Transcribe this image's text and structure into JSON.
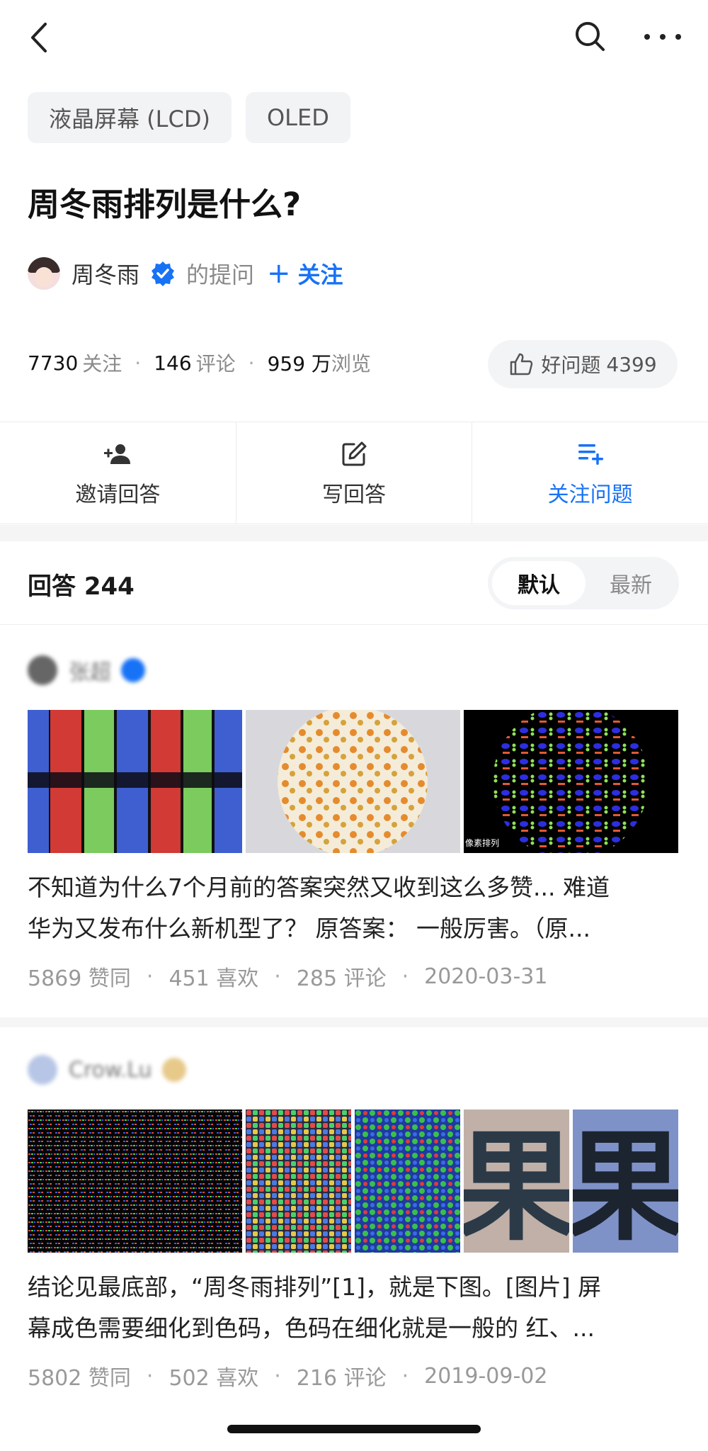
{
  "topbar": {
    "back_icon": "chevron-left-icon",
    "search_icon": "search-icon",
    "more_icon": "more-horizontal-icon"
  },
  "tags": [
    "液晶屏幕 (LCD)",
    "OLED"
  ],
  "question": {
    "title": "周冬雨排列是什么?",
    "asker_name": "周冬雨",
    "asked_label": "的提问",
    "follow_label": "关注"
  },
  "stats": {
    "followers": "7730",
    "followers_label": "关注",
    "comments": "146",
    "comments_label": "评论",
    "views": "959 万",
    "views_label": "浏览",
    "good_question_label": "好问题",
    "good_question_count": "4399"
  },
  "actions": {
    "invite": "邀请回答",
    "write": "写回答",
    "follow_question": "关注问题"
  },
  "answers": {
    "title": "回答 244",
    "sort_default": "默认",
    "sort_latest": "最新",
    "items": [
      {
        "author": "张超",
        "excerpt_line1": "不知道为什么7个月前的答案突然又收到这么多赞... 难道",
        "excerpt_line2": "华为又发布什么新机型了？ 原答案： 一般厉害。（原...",
        "image_caption": "像素排列",
        "likes": "5869 赞同",
        "loves": "451 喜欢",
        "comments": "285 评论",
        "date": "2020-03-31"
      },
      {
        "author": "Crow.Lu",
        "excerpt_line1": "结论见最底部，“周冬雨排列”[1]，就是下图。[图片] 屏",
        "excerpt_line2": "幕成色需要细化到色码，色码在细化就是一般的 红、...",
        "image_glyph": "果",
        "likes": "5802 赞同",
        "loves": "502 喜欢",
        "comments": "216 评论",
        "date": "2019-09-02"
      }
    ]
  },
  "colors": {
    "accent": "#1772f6",
    "muted": "#8a8a8a",
    "tag_bg": "#f2f3f5"
  }
}
